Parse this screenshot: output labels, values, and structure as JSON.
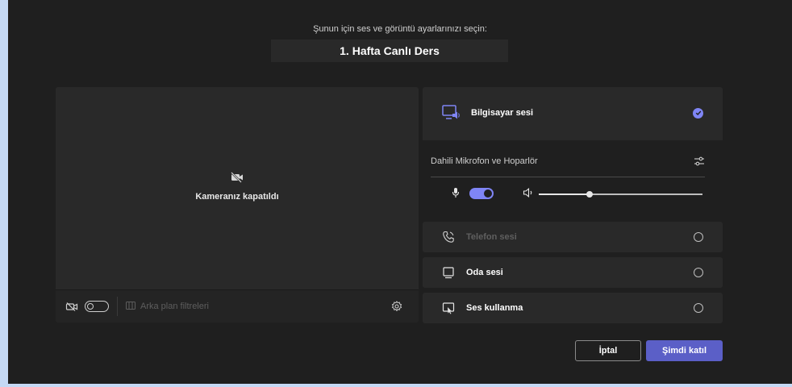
{
  "header": {
    "subtitle": "Şunun için ses ve görüntü ayarlarınızı seçin:",
    "meeting_title": "1. Hafta Canlı Ders"
  },
  "video": {
    "camera_off_label": "Kameranız kapatıldı",
    "camera_toggle_on": false,
    "background_filters_label": "Arka plan filtreleri"
  },
  "audio": {
    "computer": {
      "label": "Bilgisayar sesi",
      "selected": true,
      "device_name": "Dahili Mikrofon ve Hoparlör",
      "mic_on": true,
      "volume_percent": 31
    },
    "phone": {
      "label": "Telefon sesi",
      "selected": false,
      "disabled": true
    },
    "room": {
      "label": "Oda sesi",
      "selected": false
    },
    "none": {
      "label": "Ses kullanma",
      "selected": false
    }
  },
  "actions": {
    "cancel_label": "İptal",
    "join_label": "Şimdi katıl"
  },
  "colors": {
    "accent": "#7f85f5",
    "primary_button": "#5b5fc7",
    "background": "#1f1f1f",
    "card": "#292929"
  }
}
